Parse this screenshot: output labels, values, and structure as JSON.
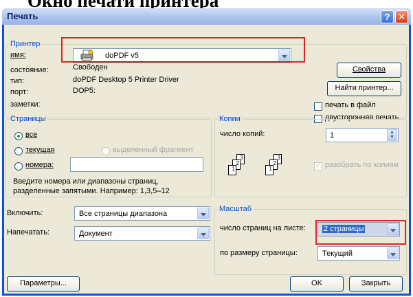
{
  "page_heading": "Окно печати принтера",
  "window": {
    "title": "Печать",
    "help": "?",
    "close": "✕"
  },
  "printer": {
    "legend": "Принтер",
    "name_label": "имя:",
    "name_value": "doPDF v5",
    "status_label": "состояние:",
    "status_value": "Свободен",
    "type_label": "тип:",
    "type_value": "doPDF  Desktop 5 Printer Driver",
    "port_label": "порт:",
    "port_value": "DOP5:",
    "notes_label": "заметки:",
    "properties_button": "Свойства",
    "find_printer_button": "Найти принтер...",
    "print_to_file": "печать в файл",
    "duplex": "двусторонняя печать",
    "icon": "printer-icon"
  },
  "pages": {
    "legend": "Страницы",
    "all": "все",
    "current": "текущая",
    "selection": "выделенный фрагмент",
    "numbers": "номера:",
    "numbers_value": "",
    "hint_line1": "Введите номера или диапазоны страниц,",
    "hint_line2": "разделенные запятыми. Например: 1,3,5–12"
  },
  "copies": {
    "legend": "Копии",
    "count_label": "число копий:",
    "count_value": "1",
    "collate": "разобрать по копиям"
  },
  "include": {
    "label": "Включить:",
    "value": "Все страницы диапазона"
  },
  "print_what": {
    "label": "Напечатать:",
    "value": "Документ"
  },
  "zoom": {
    "legend": "Масштаб",
    "pages_per_sheet_label": "число страниц на листе:",
    "pages_per_sheet_value": "2 страницы",
    "scale_label": "по размеру страницы:",
    "scale_value": "Текущий"
  },
  "footer": {
    "options": "Параметры...",
    "ok": "OK",
    "close": "Закрыть"
  },
  "colors": {
    "title_text": "#0a246a",
    "legend": "#0046d5",
    "highlight": "#e0242c",
    "body": "#ece9d8"
  }
}
